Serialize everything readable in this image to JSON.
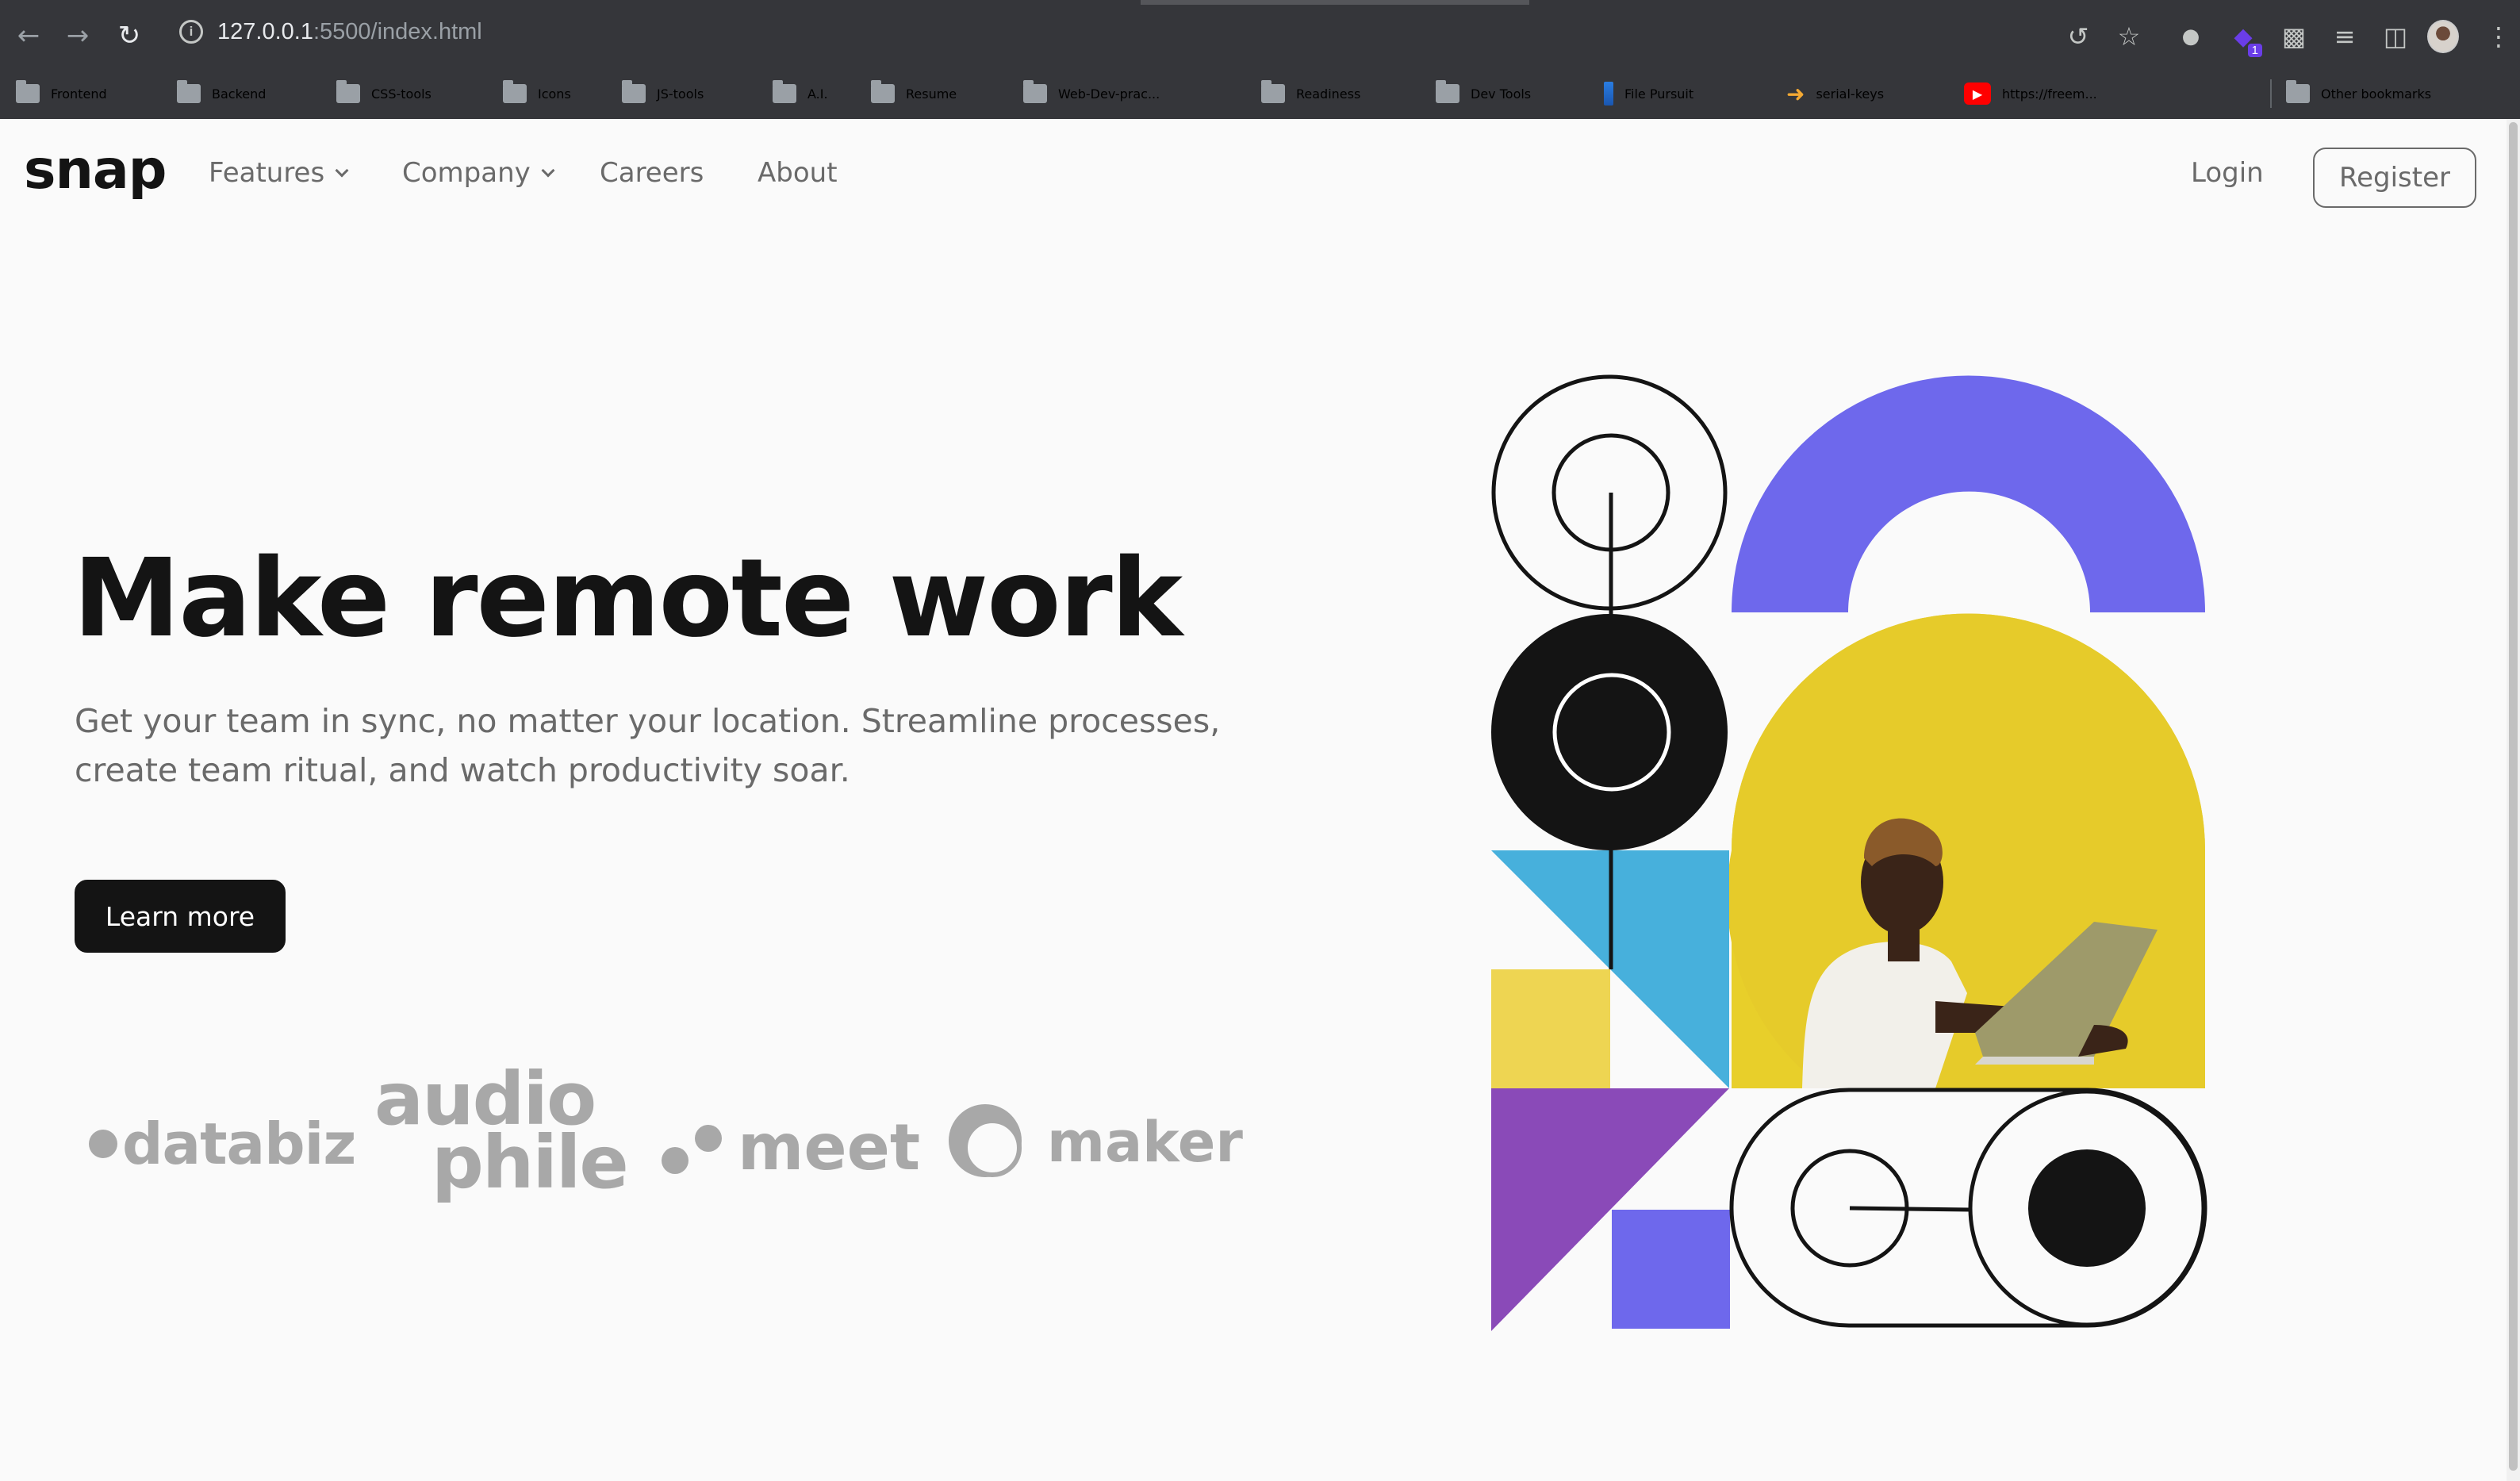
{
  "browser": {
    "url_host": "127.0.0.1",
    "url_path": ":5500/index.html",
    "extension_badge": "1",
    "bookmarks": [
      "Frontend",
      "Backend",
      "CSS-tools",
      "Icons",
      "JS-tools",
      "A.I.",
      "Resume",
      "Web-Dev-prac...",
      "Readiness",
      "Dev Tools",
      "File Pursuit",
      "serial-keys",
      "https://freem...",
      "Other bookmarks"
    ],
    "icons": {
      "back": "arrow-left-icon",
      "forward": "arrow-right-icon",
      "reload": "reload-icon",
      "info": "info-icon",
      "share": "share-icon",
      "star": "star-icon",
      "extensions": "puzzle-icon",
      "reading_list": "reading-list-icon",
      "side_panel": "side-panel-icon",
      "menu": "kebab-menu-icon"
    }
  },
  "site": {
    "logo": "snap",
    "nav": {
      "features": "Features",
      "company": "Company",
      "careers": "Careers",
      "about": "About"
    },
    "login": "Login",
    "register": "Register",
    "headline": "Make remote work",
    "subtitle": "Get your team in sync, no matter your location. Streamline processes, create team ritual, and watch productivity soar.",
    "cta": "Learn more",
    "clients": {
      "databiz": "databiz",
      "audiophile_1": "audio",
      "audiophile_2": "phile",
      "meet": "meet",
      "maker": "maker"
    },
    "colors": {
      "text_dark": "#141414",
      "text_gray": "#6a6a6a",
      "violet": "#6e68ec",
      "yellow": "#e8cf2a",
      "blue": "#47b0dc",
      "purple": "#8a4ab8"
    }
  }
}
